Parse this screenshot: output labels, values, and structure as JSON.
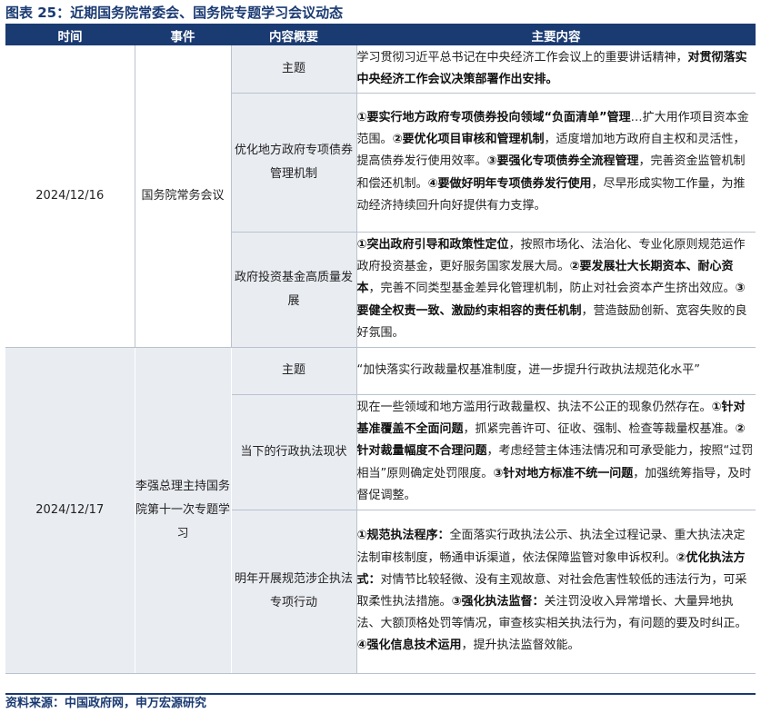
{
  "figure_title": "图表 25：近期国务院常委会、国务院专题学习会议动态",
  "headers": [
    "时间",
    "事件",
    "内容概要",
    "主要内容"
  ],
  "groups": [
    {
      "date": "2024/12/16",
      "event": "国务院常务会议",
      "rows": [
        {
          "summary": "主题",
          "content": [
            {
              "t": "学习贯彻习近平总书记在中央经济工作会议上的重要讲话精神，",
              "b": false
            },
            {
              "t": "对贯彻落实中央经济工作会议决策部署作出安排。",
              "b": true
            }
          ]
        },
        {
          "summary": "优化地方政府专项债券管理机制",
          "content": [
            {
              "t": "①要实行地方政府专项债券投向领域“负面清单”管理",
              "b": true
            },
            {
              "t": "…扩大用作项目资本金范围。",
              "b": false
            },
            {
              "t": "②要优化项目审核和管理机制",
              "b": true
            },
            {
              "t": "，适度增加地方政府自主权和灵活性，提高债券发行使用效率。",
              "b": false
            },
            {
              "t": "③要强化专项债券全流程管理",
              "b": true
            },
            {
              "t": "，完善资金监管机制和偿还机制。",
              "b": false
            },
            {
              "t": "④要做好明年专项债券发行使用",
              "b": true
            },
            {
              "t": "，尽早形成实物工作量，为推动经济持续回升向好提供有力支撑。",
              "b": false
            }
          ]
        },
        {
          "summary": "政府投资基金高质量发展",
          "content": [
            {
              "t": "①突出政府引导和政策性定位",
              "b": true
            },
            {
              "t": "，按照市场化、法治化、专业化原则规范运作政府投资基金，更好服务国家发展大局。",
              "b": false
            },
            {
              "t": "②要发展壮大长期资本、耐心资本",
              "b": true
            },
            {
              "t": "，完善不同类型基金差异化管理机制，防止对社会资本产生挤出效应。",
              "b": false
            },
            {
              "t": "③要健全权责一致、激励约束相容的责任机制",
              "b": true
            },
            {
              "t": "，营造鼓励创新、宽容失败的良好氛围。",
              "b": false
            }
          ]
        }
      ]
    },
    {
      "date": "2024/12/17",
      "event": "李强总理主持国务院第十一次专题学习",
      "rows": [
        {
          "summary": "主题",
          "content": [
            {
              "t": "“加快落实行政裁量权基准制度，进一步提升行政执法规范化水平”",
              "b": false
            }
          ]
        },
        {
          "summary": "当下的行政执法现状",
          "content": [
            {
              "t": "现在一些领域和地方滥用行政裁量权、执法不公正的现象仍然存在。",
              "b": false
            },
            {
              "t": "①针对基准覆盖不全面问题",
              "b": true
            },
            {
              "t": "，抓紧完善许可、征收、强制、检查等裁量权基准。",
              "b": false
            },
            {
              "t": "②针对裁量幅度不合理问题",
              "b": true
            },
            {
              "t": "，考虑经营主体违法情况和可承受能力，按照“过罚相当”原则确定处罚限度。",
              "b": false
            },
            {
              "t": "③针对地方标准不统一问题",
              "b": true
            },
            {
              "t": "，加强统筹指导，及时督促调整。",
              "b": false
            }
          ]
        },
        {
          "summary": "明年开展规范涉企执法专项行动",
          "content": [
            {
              "t": "①规范执法程序：",
              "b": true
            },
            {
              "t": "全面落实行政执法公示、执法全过程记录、重大执法决定法制审核制度，畅通申诉渠道，依法保障监管对象申诉权利。",
              "b": false
            },
            {
              "t": "②优化执法方式：",
              "b": true
            },
            {
              "t": "对情节比较轻微、没有主观故意、对社会危害性较低的违法行为，可采取柔性执法措施。",
              "b": false
            },
            {
              "t": "③强化执法监督：",
              "b": true
            },
            {
              "t": "关注罚没收入异常增长、大量异地执法、大额顶格处罚等情况，审查核实相关执法行为，有问题的要及时纠正。",
              "b": false
            },
            {
              "t": "④强化信息技术运用",
              "b": true
            },
            {
              "t": "，提升执法监督效能。",
              "b": false
            }
          ]
        }
      ]
    }
  ],
  "source": "资料来源：中国政府网，申万宏源研究",
  "colors": {
    "header_bg": "#1a3a72",
    "shade": "#e9ecf1",
    "rule": "#b9c2cf"
  }
}
